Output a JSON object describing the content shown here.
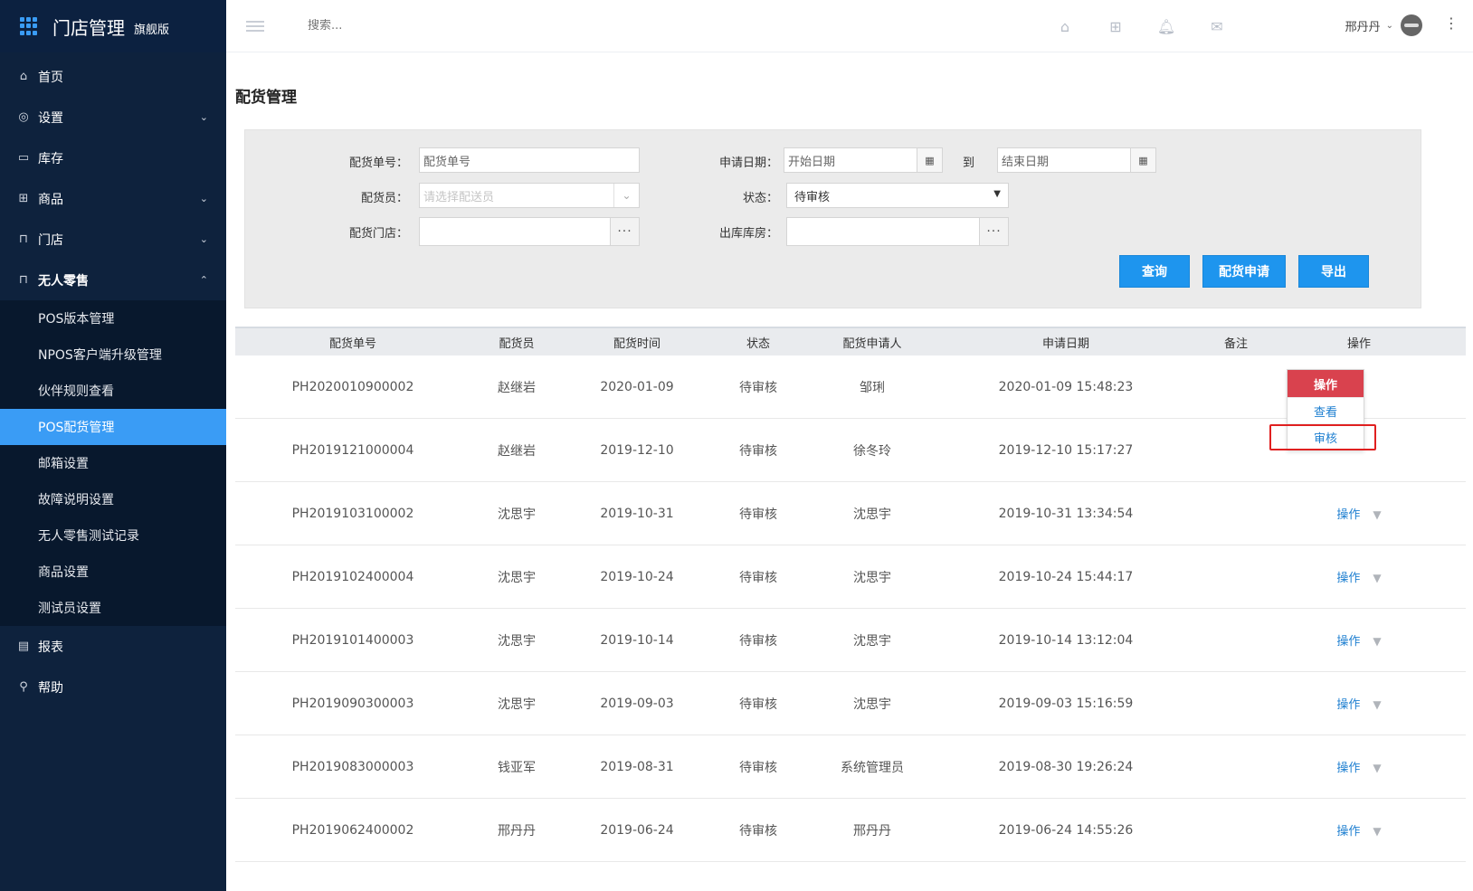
{
  "brand": {
    "title": "门店管理",
    "subtitle": "旗舰版",
    "accent": "#3a9cf5"
  },
  "sidebar": {
    "items": [
      {
        "label": "首页",
        "icon": "home-icon",
        "glyph": "⌂"
      },
      {
        "label": "设置",
        "icon": "settings-icon",
        "glyph": "◎",
        "arrow": "⌄"
      },
      {
        "label": "库存",
        "icon": "inventory-icon",
        "glyph": "▭"
      },
      {
        "label": "商品",
        "icon": "gift-icon",
        "glyph": "⊞",
        "arrow": "⌄"
      },
      {
        "label": "门店",
        "icon": "store-icon",
        "glyph": "⊓",
        "arrow": "⌄"
      },
      {
        "label": "无人零售",
        "icon": "store-icon",
        "glyph": "⊓",
        "arrow": "⌃"
      }
    ],
    "submenu": [
      "POS版本管理",
      "NPOS客户端升级管理",
      "伙伴规则查看",
      "POS配货管理",
      "邮箱设置",
      "故障说明设置",
      "无人零售测试记录",
      "商品设置",
      "测试员设置"
    ],
    "tail": [
      {
        "label": "报表",
        "icon": "report-icon",
        "glyph": "▤"
      },
      {
        "label": "帮助",
        "icon": "wrench-icon",
        "glyph": "⚲"
      }
    ]
  },
  "header": {
    "search_placeholder": "搜索...",
    "user_name": "邢丹丹",
    "icons": [
      "home-icon",
      "apps-icon",
      "bell-icon",
      "mail-icon"
    ]
  },
  "page": {
    "title": "配货管理"
  },
  "filters": {
    "order_no_label": "配货单号：",
    "order_no_placeholder": "配货单号",
    "apply_date_label": "申请日期：",
    "start_placeholder": "开始日期",
    "to_label": "到",
    "end_placeholder": "结束日期",
    "dispatcher_label": "配货员：",
    "dispatcher_placeholder": "请选择配送员",
    "status_label": "状态：",
    "status_value": "待审核",
    "store_label": "配货门店：",
    "warehouse_label": "出库库房：",
    "buttons": {
      "query": "查询",
      "apply": "配货申请",
      "export": "导出"
    }
  },
  "table": {
    "headers": [
      "配货单号",
      "配货员",
      "配货时间",
      "状态",
      "配货申请人",
      "申请日期",
      "备注",
      "操作"
    ],
    "rows": [
      [
        "PH2020010900002",
        "赵继岩",
        "2020-01-09",
        "待审核",
        "邹琍",
        "2020-01-09 15:48:23",
        "",
        "操作"
      ],
      [
        "PH2019121000004",
        "赵继岩",
        "2019-12-10",
        "待审核",
        "徐冬玲",
        "2019-12-10 15:17:27",
        "",
        ""
      ],
      [
        "PH2019103100002",
        "沈思宇",
        "2019-10-31",
        "待审核",
        "沈思宇",
        "2019-10-31 13:34:54",
        "",
        "操作"
      ],
      [
        "PH2019102400004",
        "沈思宇",
        "2019-10-24",
        "待审核",
        "沈思宇",
        "2019-10-24 15:44:17",
        "",
        "操作"
      ],
      [
        "PH2019101400003",
        "沈思宇",
        "2019-10-14",
        "待审核",
        "沈思宇",
        "2019-10-14 13:12:04",
        "",
        "操作"
      ],
      [
        "PH2019090300003",
        "沈思宇",
        "2019-09-03",
        "待审核",
        "沈思宇",
        "2019-09-03 15:16:59",
        "",
        "操作"
      ],
      [
        "PH2019083000003",
        "钱亚军",
        "2019-08-31",
        "待审核",
        "系统管理员",
        "2019-08-30 19:26:24",
        "",
        "操作"
      ],
      [
        "PH2019062400002",
        "邢丹丹",
        "2019-06-24",
        "待审核",
        "邢丹丹",
        "2019-06-24 14:55:26",
        "",
        "操作"
      ]
    ],
    "dropdown": {
      "head": "操作",
      "items": [
        "查看",
        "审核"
      ]
    }
  }
}
